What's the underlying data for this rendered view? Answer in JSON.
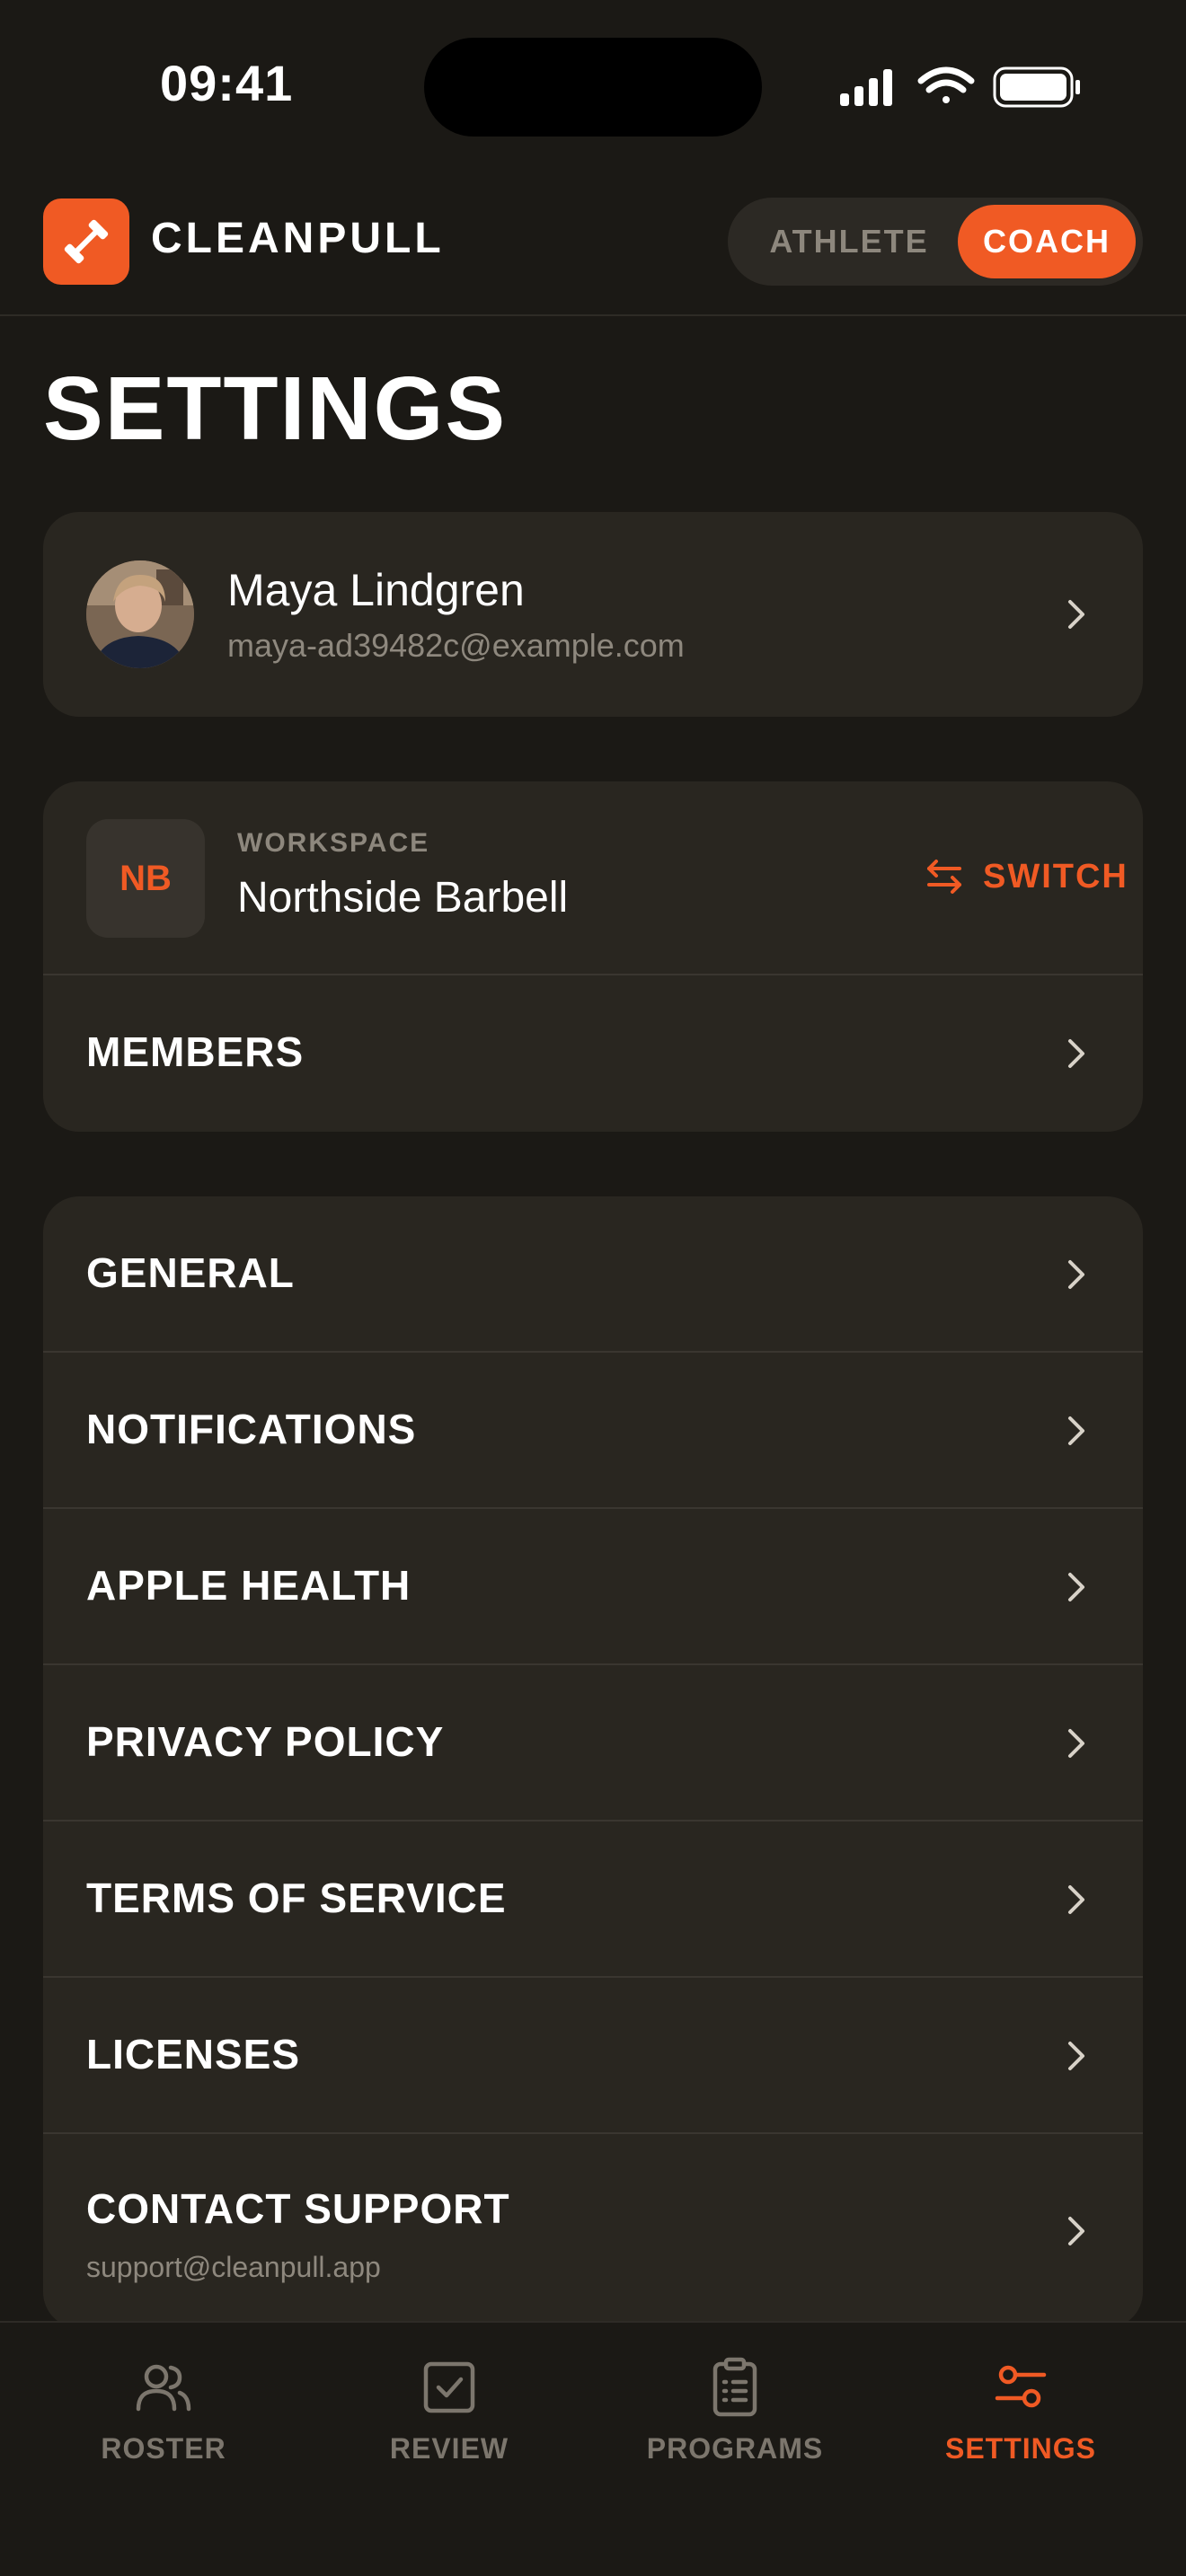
{
  "status_bar": {
    "time": "09:41",
    "icons": [
      "signal-icon",
      "wifi-icon",
      "battery-icon"
    ]
  },
  "header": {
    "brand": "CLEANPULL",
    "logo_icon": "dumbbell-icon",
    "roles": [
      "ATHLETE",
      "COACH"
    ],
    "active_role": "COACH"
  },
  "page_title": "SETTINGS",
  "profile": {
    "name": "Maya Lindgren",
    "email": "maya-ad39482c@example.com"
  },
  "workspace": {
    "badge": "NB",
    "caption": "WORKSPACE",
    "name": "Northside Barbell",
    "switch_label": "SWITCH",
    "members_label": "MEMBERS"
  },
  "settings_items": [
    {
      "label": "GENERAL"
    },
    {
      "label": "NOTIFICATIONS"
    },
    {
      "label": "APPLE HEALTH"
    },
    {
      "label": "PRIVACY POLICY"
    },
    {
      "label": "TERMS OF SERVICE"
    },
    {
      "label": "LICENSES"
    },
    {
      "label": "CONTACT SUPPORT",
      "sub": "support@cleanpull.app"
    }
  ],
  "tabs": [
    {
      "label": "ROSTER",
      "icon": "users-icon"
    },
    {
      "label": "REVIEW",
      "icon": "check-square-icon"
    },
    {
      "label": "PROGRAMS",
      "icon": "clipboard-list-icon"
    },
    {
      "label": "SETTINGS",
      "icon": "sliders-icon",
      "active": true
    }
  ],
  "colors": {
    "accent": "#f05a24",
    "background": "#1b1915",
    "card": "#292620"
  }
}
